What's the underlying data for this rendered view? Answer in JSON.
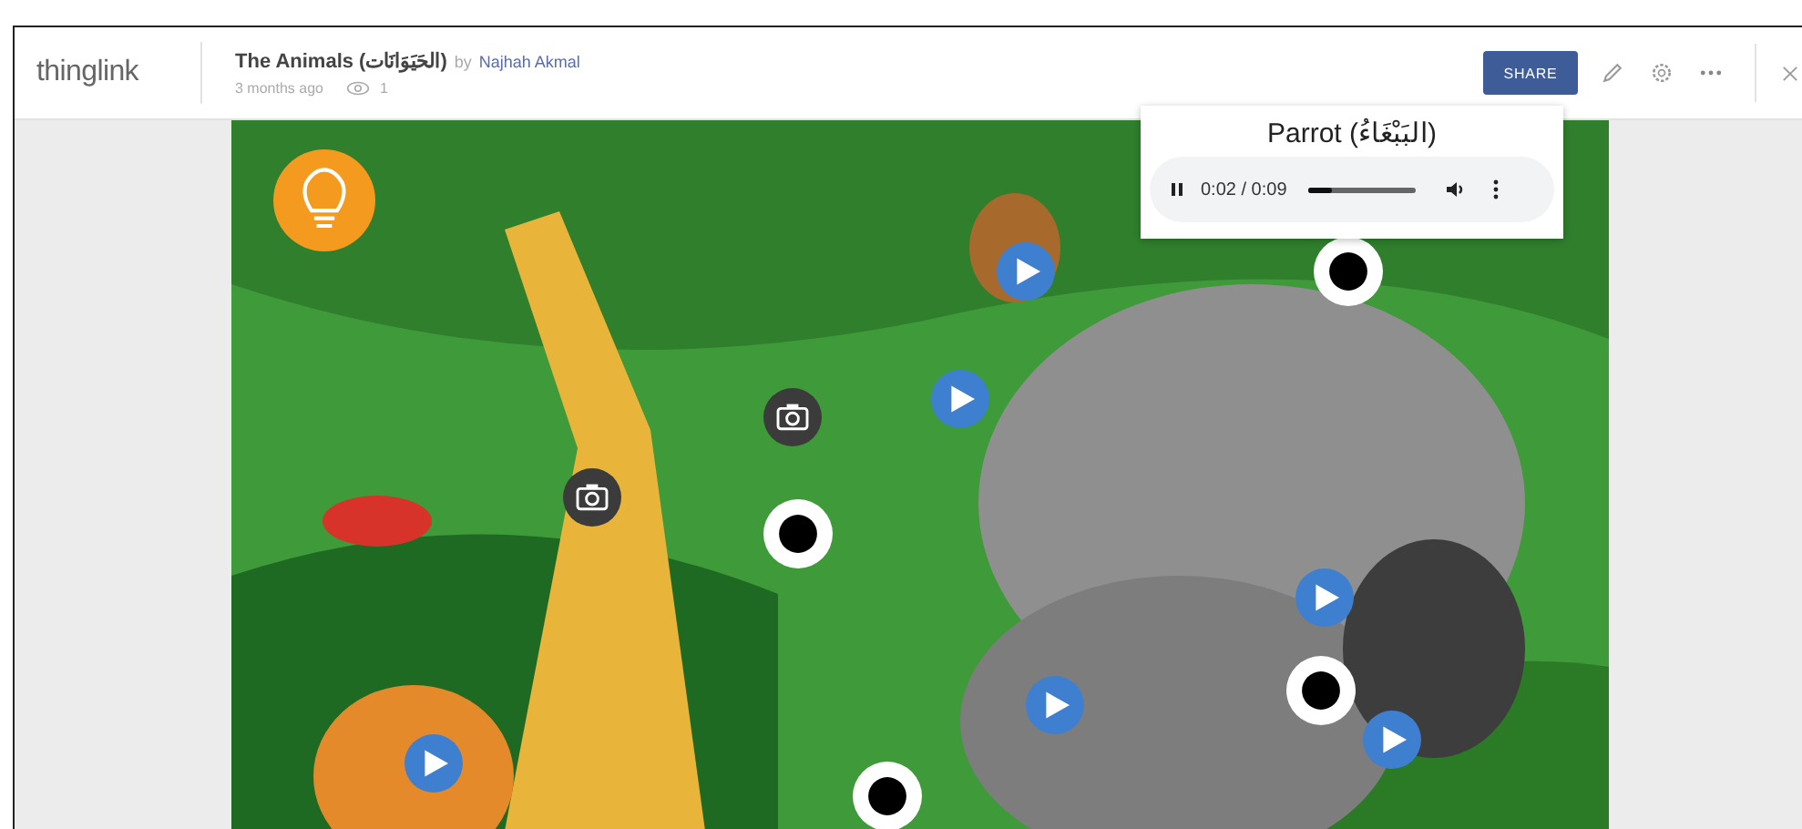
{
  "header": {
    "logo": "thinglink",
    "title": "The Animals (الحَيَوَانَات)",
    "by": "by",
    "author": "Najhah Akmal",
    "age": "3 months ago",
    "views": "1",
    "share_button": "SHARE"
  },
  "popup": {
    "title": "Parrot (البَبْغَاءُ)",
    "player": {
      "playing": true,
      "time": "0:02 / 0:09",
      "level": 0.22
    }
  }
}
